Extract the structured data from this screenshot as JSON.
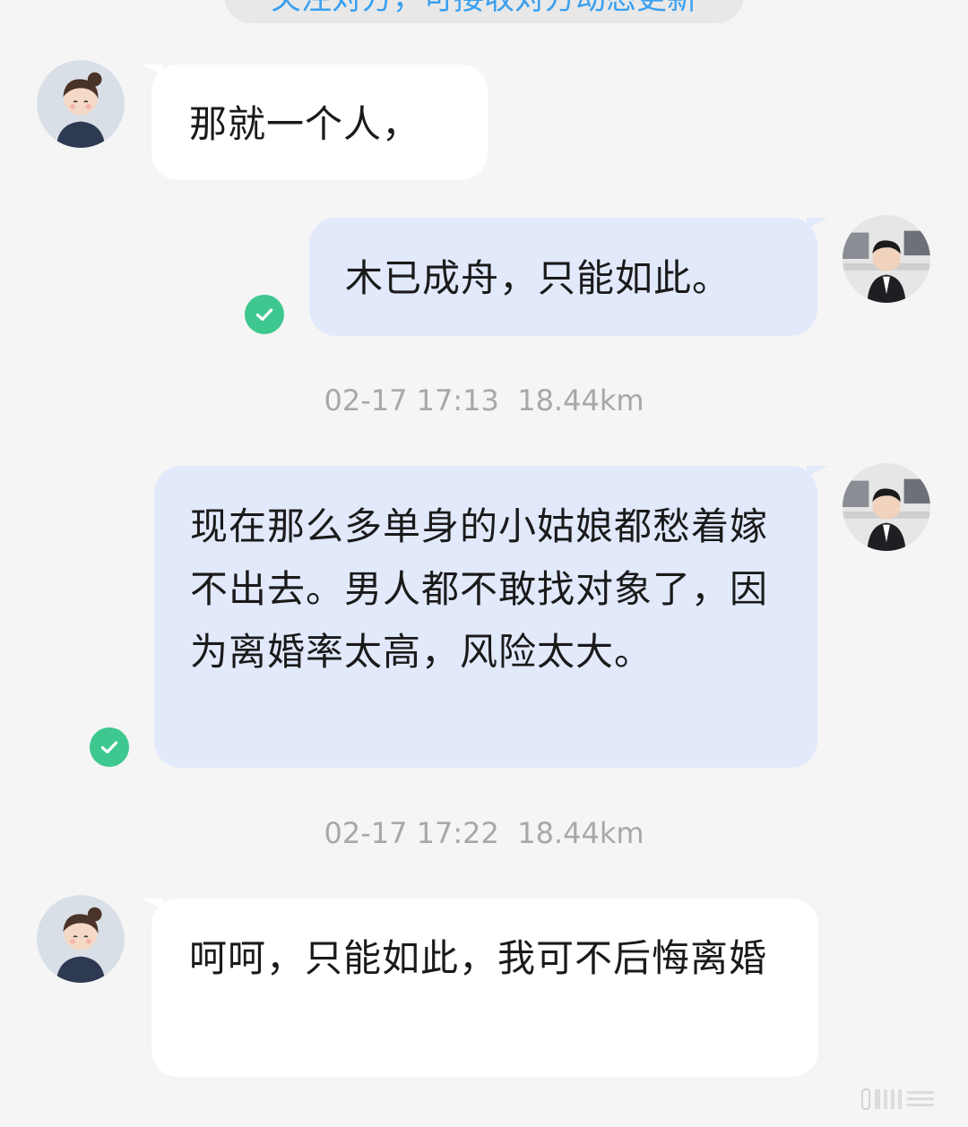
{
  "top_notice": "关注对方，可接收对方动态更新",
  "messages": [
    {
      "direction": "incoming",
      "text": "那就一个人，"
    },
    {
      "direction": "outgoing",
      "text": "木已成舟，只能如此。",
      "status": "read-check"
    },
    {
      "direction": "outgoing",
      "text": "现在那么多单身的小姑娘都愁着嫁不出去。男人都不敢找对象了，因为离婚率太高，风险太大。",
      "status": "read-check"
    },
    {
      "direction": "incoming",
      "text": "呵呵，只能如此，我可不后悔离婚"
    }
  ],
  "timestamps": [
    {
      "time": "02-17 17:13",
      "distance": "18.44km"
    },
    {
      "time": "02-17 17:22",
      "distance": "18.44km"
    }
  ],
  "icons": {
    "read_status": "check-circle-icon",
    "contact_avatar": "girl-avatar",
    "self_avatar": "boy-in-suit-avatar"
  },
  "colors": {
    "background": "#f5f5f5",
    "incoming_bubble": "#ffffff",
    "outgoing_bubble": "#e1e9fb",
    "check": "#3ec88f",
    "notice_text": "#3aa0f0",
    "timestamp": "#a8a8a8"
  }
}
